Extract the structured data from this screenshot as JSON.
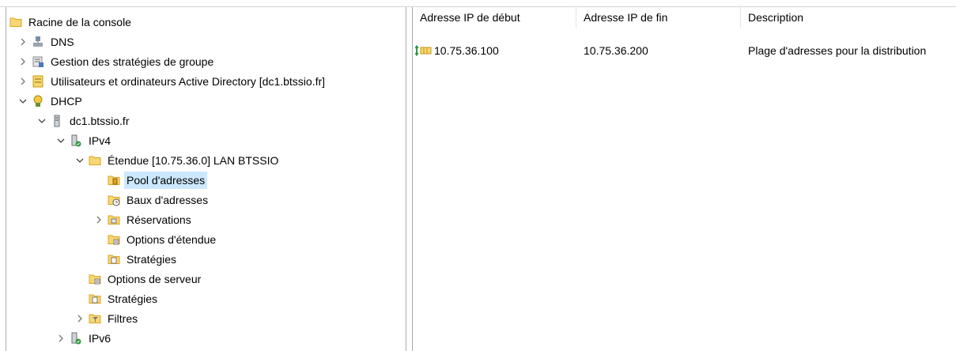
{
  "tree": {
    "root": "Racine de la console",
    "dns": "DNS",
    "gpo": "Gestion des stratégies de groupe",
    "ad_users": "Utilisateurs et ordinateurs Active Directory [dc1.btssio.fr]",
    "dhcp": "DHCP",
    "server": "dc1.btssio.fr",
    "ipv4": "IPv4",
    "scope": "Étendue [10.75.36.0] LAN BTSSIO",
    "pool": "Pool d'adresses",
    "leases": "Baux d'adresses",
    "reservations": "Réservations",
    "scope_options": "Options d'étendue",
    "scope_policies": "Stratégies",
    "server_options": "Options de serveur",
    "server_policies": "Stratégies",
    "filters": "Filtres",
    "ipv6": "IPv6"
  },
  "list": {
    "columns": [
      "Adresse IP de début",
      "Adresse IP de fin",
      "Description"
    ],
    "rows": [
      [
        "10.75.36.100",
        "10.75.36.200",
        "Plage d'adresses pour la distribution"
      ]
    ]
  },
  "colors": {
    "selection": "#cce8ff",
    "folder": "#f8d775",
    "divider": "#adadad"
  }
}
